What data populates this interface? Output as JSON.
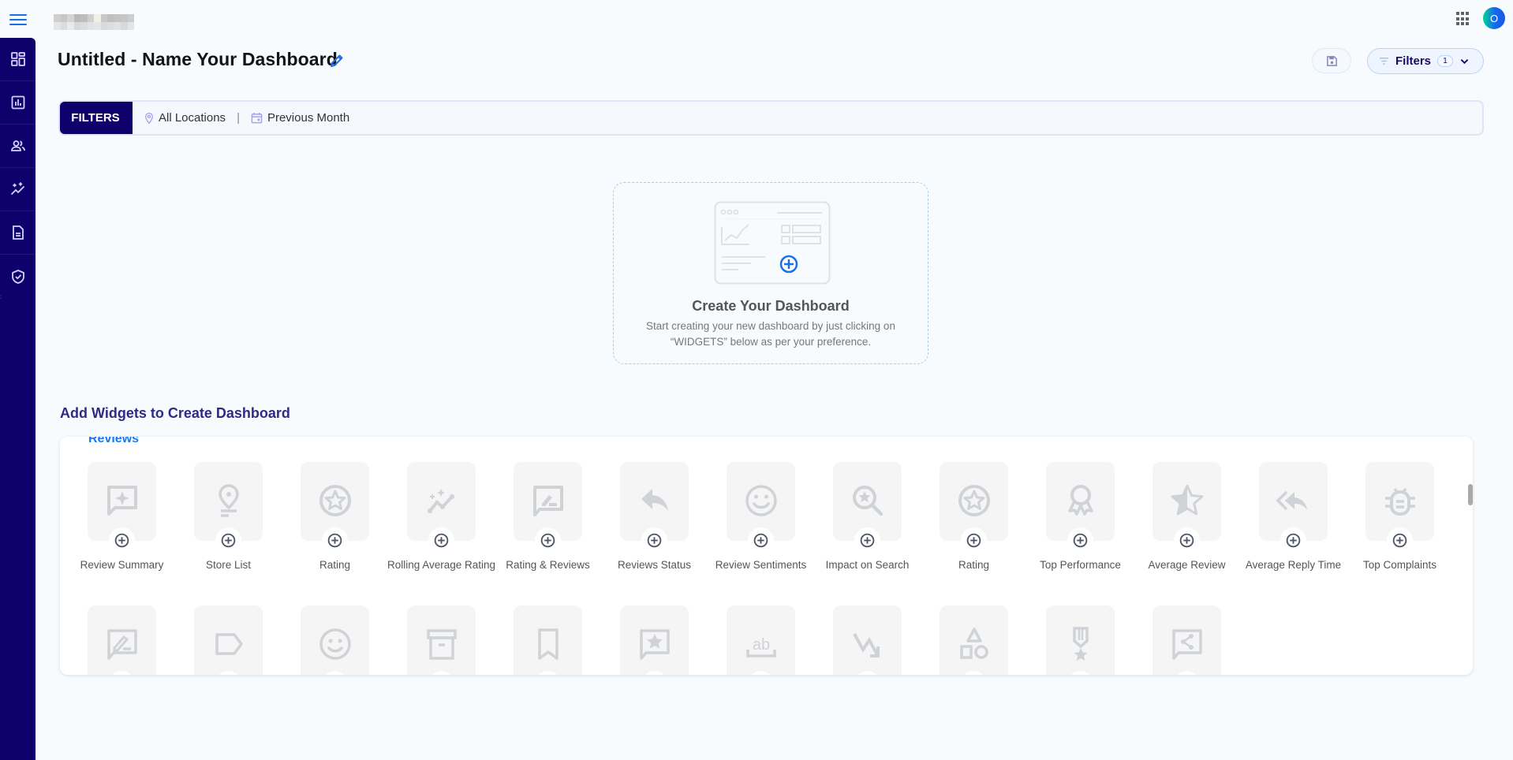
{
  "header": {
    "menu_icon": "hamburger-icon",
    "logo": "blurred-logo",
    "apps_icon": "apps-grid-icon",
    "avatar_initial": "O"
  },
  "sidebar": {
    "items": [
      {
        "name": "dashboard",
        "icon": "dashboard-grid-icon"
      },
      {
        "name": "reports",
        "icon": "bar-chart-icon"
      },
      {
        "name": "users",
        "icon": "users-icon"
      },
      {
        "name": "insights",
        "icon": "trend-sparkle-icon"
      },
      {
        "name": "documents",
        "icon": "document-icon"
      },
      {
        "name": "security",
        "icon": "shield-check-icon"
      }
    ]
  },
  "page": {
    "title": "Untitled - Name Your Dashboard",
    "filters_button_label": "Filters",
    "filters_count": "1"
  },
  "filter_bar": {
    "tag": "FILTERS",
    "location": "All Locations",
    "separator": "|",
    "period": "Previous Month"
  },
  "create_card": {
    "title": "Create Your Dashboard",
    "description": "Start creating your new dashboard by just clicking on “WIDGETS” below as per your preference."
  },
  "widgets": {
    "heading": "Add Widgets to Create Dashboard",
    "section": "Reviews",
    "row1": [
      {
        "label": "Review Summary",
        "icon": "chat-sparkle-icon"
      },
      {
        "label": "Store List",
        "icon": "location-pin-list-icon"
      },
      {
        "label": "Rating",
        "icon": "star-circle-icon"
      },
      {
        "label": "Rolling Average Rating",
        "icon": "trend-sparkle-icon"
      },
      {
        "label": "Rating & Reviews",
        "icon": "chat-edit-icon"
      },
      {
        "label": "Reviews Status",
        "icon": "reply-icon"
      },
      {
        "label": "Review Sentiments",
        "icon": "smiley-icon"
      },
      {
        "label": "Impact on Search",
        "icon": "search-star-icon"
      },
      {
        "label": "Rating",
        "icon": "star-circle-icon"
      },
      {
        "label": "Top Performance",
        "icon": "award-ribbon-icon"
      },
      {
        "label": "Average Review",
        "icon": "half-star-icon"
      },
      {
        "label": "Average Reply Time",
        "icon": "reply-all-icon"
      },
      {
        "label": "Top Complaints",
        "icon": "bug-icon"
      }
    ],
    "row2": [
      {
        "icon": "chat-pen-icon"
      },
      {
        "icon": "label-tag-icon"
      },
      {
        "icon": "smiley-outline-icon"
      },
      {
        "icon": "archive-box-icon"
      },
      {
        "icon": "bookmark-icon"
      },
      {
        "icon": "chat-star-icon"
      },
      {
        "icon": "text-ab-icon"
      },
      {
        "icon": "trend-down-icon"
      },
      {
        "icon": "shapes-icon"
      },
      {
        "icon": "medal-star-icon"
      },
      {
        "icon": "chat-share-icon"
      }
    ]
  }
}
